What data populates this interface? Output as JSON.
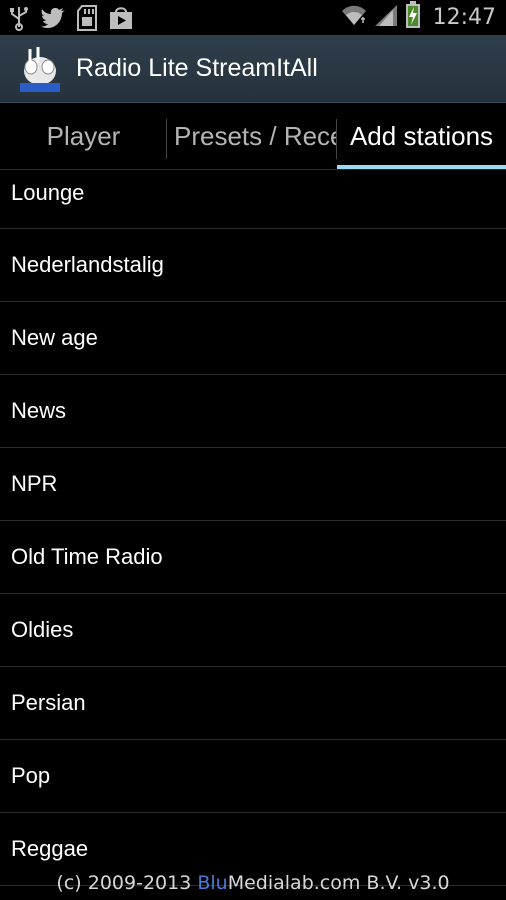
{
  "status_bar": {
    "time": "12:47",
    "icons_left": [
      "usb-icon",
      "twitter-icon",
      "sd-card-icon",
      "play-store-icon"
    ],
    "icons_right": [
      "wifi-icon",
      "signal-icon",
      "battery-charging-icon"
    ]
  },
  "action_bar": {
    "title": "Radio Lite StreamItAll",
    "logo_text": "RADIO"
  },
  "tabs": [
    {
      "label": "Player",
      "active": false
    },
    {
      "label": "Presets / Recent",
      "active": false
    },
    {
      "label": "Add stations",
      "active": true
    }
  ],
  "stations": [
    "Lounge",
    "Nederlandstalig",
    "New age",
    "News",
    "NPR",
    "Old Time Radio",
    "Oldies",
    "Persian",
    "Pop",
    "Reggae"
  ],
  "footer": {
    "prefix": "(c) 2009-2013 ",
    "blu": "Blu",
    "suffix": "Medialab.com B.V. v3.0"
  },
  "colors": {
    "accent": "#9ed7ef",
    "actionbar": "#2f3e4b",
    "blu_link": "#4b7bd6"
  }
}
